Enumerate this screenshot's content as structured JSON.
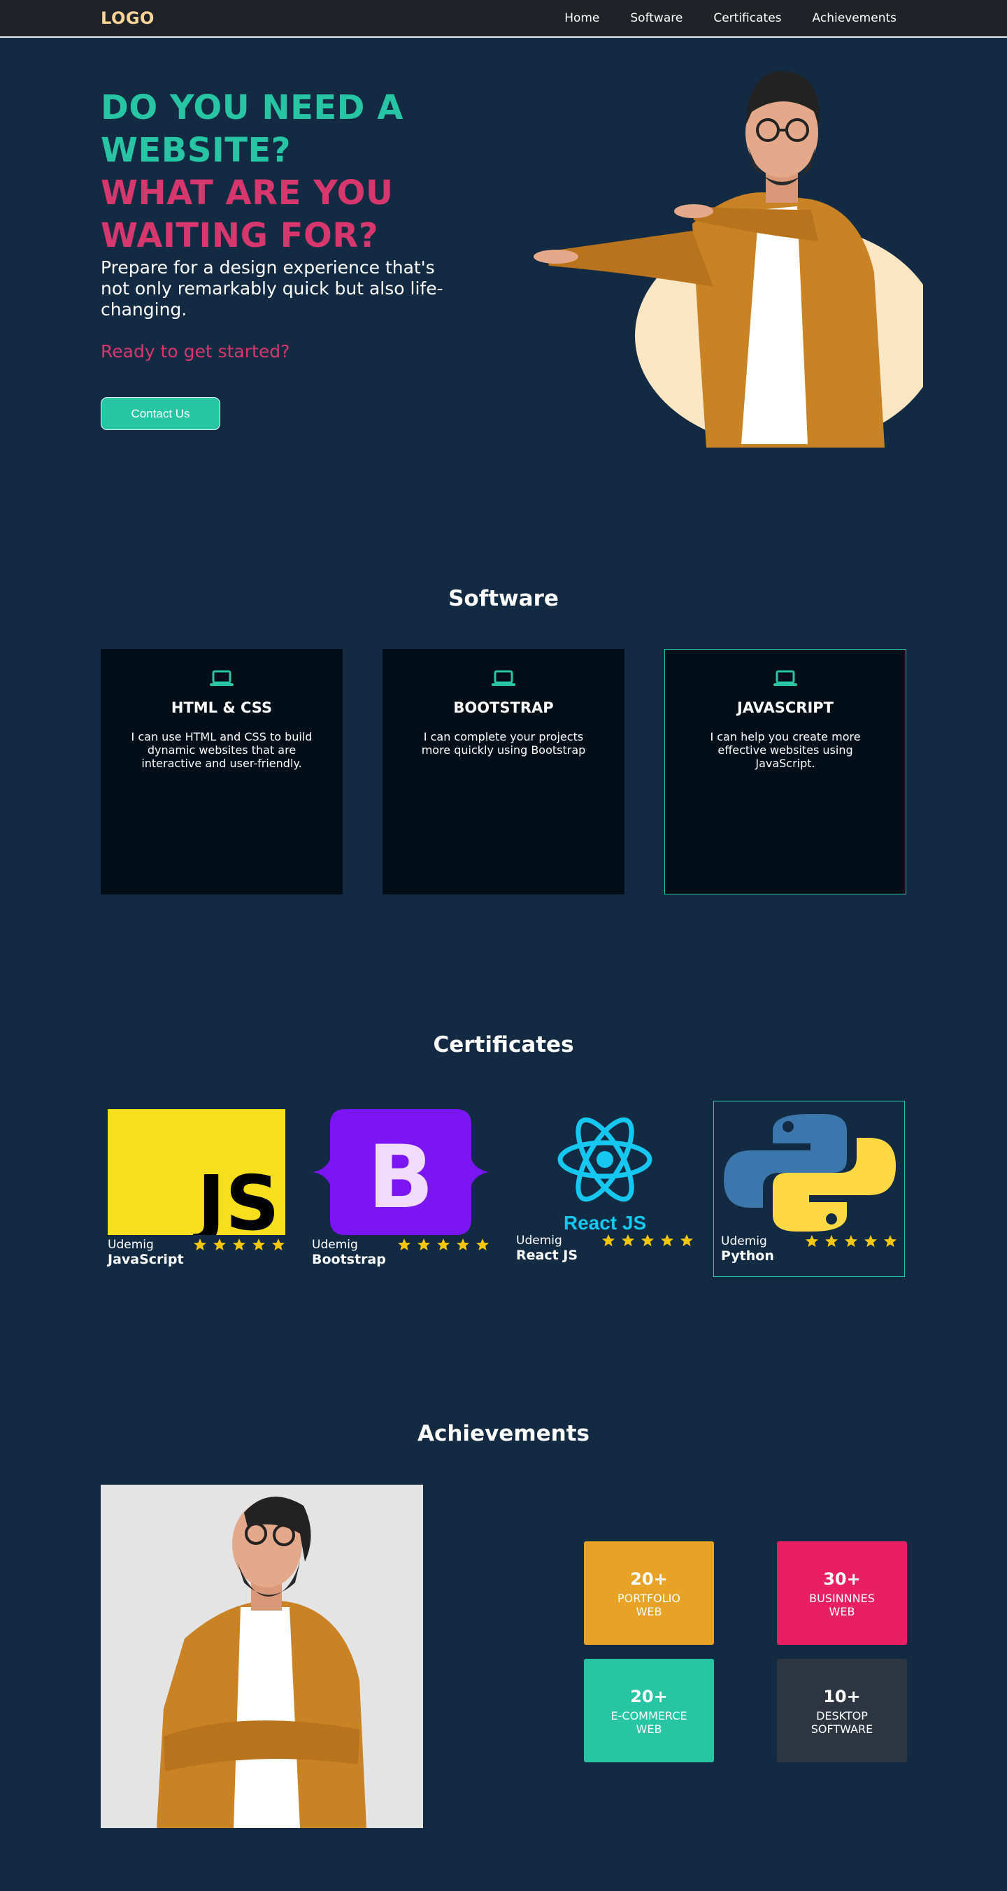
{
  "nav": {
    "logo": "LOGO",
    "links": [
      "Home",
      "Software",
      "Certificates",
      "Achievements"
    ]
  },
  "hero": {
    "title_line1": "DO YOU NEED A WEBSITE?",
    "title_line2": "WHAT ARE YOU WAITING FOR?",
    "subtitle": "Prepare for a design experience that's not only remarkably quick but also life-changing.",
    "ready": "Ready to get started?",
    "button": "Contact Us"
  },
  "software": {
    "title": "Software",
    "cards": [
      {
        "title": "HTML & CSS",
        "text": "I can use HTML and CSS to build dynamic websites that are interactive and user-friendly."
      },
      {
        "title": "BOOTSTRAP",
        "text": "I can complete your projects more quickly using Bootstrap"
      },
      {
        "title": "JAVASCRIPT",
        "text": "I can help you create more effective websites using JavaScript."
      }
    ]
  },
  "certificates": {
    "title": "Certificates",
    "items": [
      {
        "issuer": "Udemig",
        "name": "JavaScript",
        "logo_text": "JS",
        "rating": 5
      },
      {
        "issuer": "Udemig",
        "name": "Bootstrap",
        "logo_text": "B",
        "rating": 5
      },
      {
        "issuer": "Udemig",
        "name": "React JS",
        "logo_text": "React JS",
        "rating": 5
      },
      {
        "issuer": "Udemig",
        "name": "Python",
        "rating": 5
      }
    ]
  },
  "achievements": {
    "title": "Achievements",
    "stats": [
      {
        "num": "20+",
        "label_line1": "PORTFOLIO",
        "label_line2": "WEB",
        "color": "#e8a326"
      },
      {
        "num": "30+",
        "label_line1": "BUSINNNES",
        "label_line2": "WEB",
        "color": "#e82063"
      },
      {
        "num": "20+",
        "label_line1": "E-COMMERCE",
        "label_line2": "WEB",
        "color": "#27c5a4"
      },
      {
        "num": "10+",
        "label_line1": "DESKTOP",
        "label_line2": "SOFTWARE",
        "color": "#2d3640"
      }
    ]
  },
  "colors": {
    "background": "#132a43",
    "accent_teal": "#27c5a4",
    "accent_pink": "#d6376d",
    "logo": "#fcd59b",
    "card_bg": "#010d17",
    "star": "#f9c80e"
  },
  "icons": [
    "laptop-icon",
    "star-icon",
    "javascript-logo",
    "bootstrap-logo",
    "react-logo",
    "python-logo"
  ]
}
